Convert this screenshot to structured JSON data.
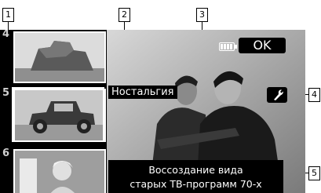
{
  "callouts": [
    "1",
    "2",
    "3",
    "4",
    "5"
  ],
  "thumbnails": [
    {
      "number": "4",
      "subject": "Desert rock formation"
    },
    {
      "number": "5",
      "subject": "Vintage car"
    },
    {
      "number": "6",
      "subject": "Portrait"
    }
  ],
  "effect_name": "Ностальгия",
  "ok_button": "OK",
  "description": {
    "line1": "Воссоздание вида",
    "line2": "старых ТВ-программ 70-х"
  },
  "icons": {
    "battery": "battery-icon",
    "settings": "wrench-icon"
  },
  "colors": {
    "panel": "#000000",
    "text": "#ffffff"
  }
}
